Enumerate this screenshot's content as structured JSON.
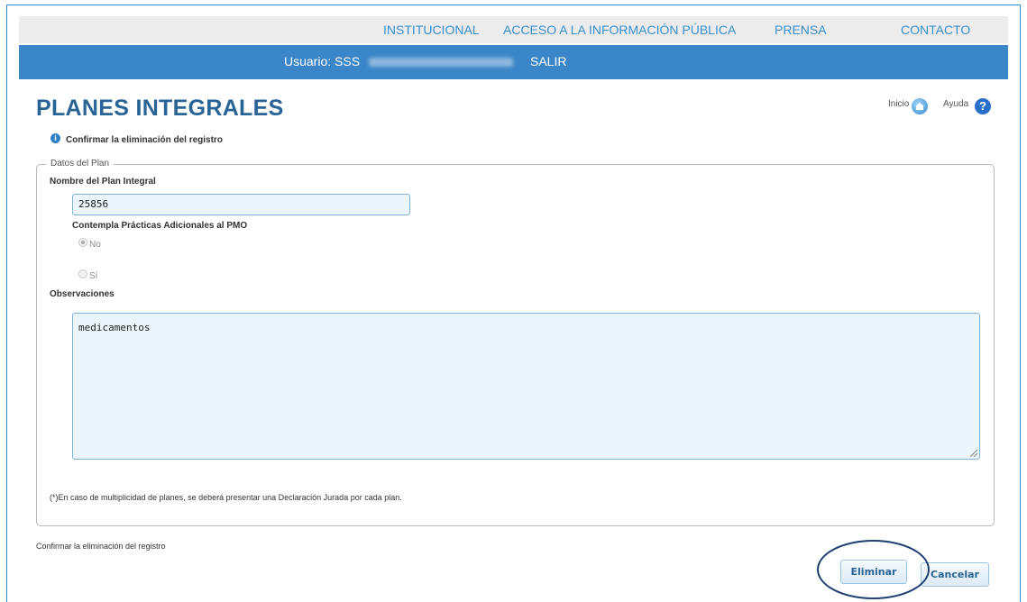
{
  "nav": {
    "items": [
      "INSTITUCIONAL",
      "ACCESO A LA INFORMACIÓN PÚBLICA",
      "PRENSA",
      "CONTACTO"
    ]
  },
  "userbar": {
    "user_label": "Usuario: SSS",
    "logout_label": "SALIR"
  },
  "page": {
    "title": "PLANES INTEGRALES",
    "home_label": "Inicio",
    "help_label": "Ayuda",
    "info_message": "Confirmar la eliminación del registro"
  },
  "form": {
    "legend": "Datos del Plan",
    "plan_name_label": "Nombre del Plan Integral",
    "plan_name_value": "25856",
    "practices_label": "Contempla Prácticas Adicionales al PMO",
    "option_no": "No",
    "option_si": "Sí",
    "option_no_selected": true,
    "observations_label": "Observaciones",
    "observations_value": "medicamentos",
    "note": "(*)En caso de multiplicidad de planes, se deberá presentar una Declaración Jurada por cada plan."
  },
  "footer": {
    "confirm_text": "Confirmar la eliminación del registro",
    "delete_label": "Eliminar",
    "cancel_label": "Cancelar"
  },
  "colors": {
    "accent": "#3a86c8",
    "title": "#2a6496",
    "annotation_ellipse": "#1f3f73"
  },
  "icons": [
    "home-icon",
    "help-icon",
    "info-icon"
  ]
}
